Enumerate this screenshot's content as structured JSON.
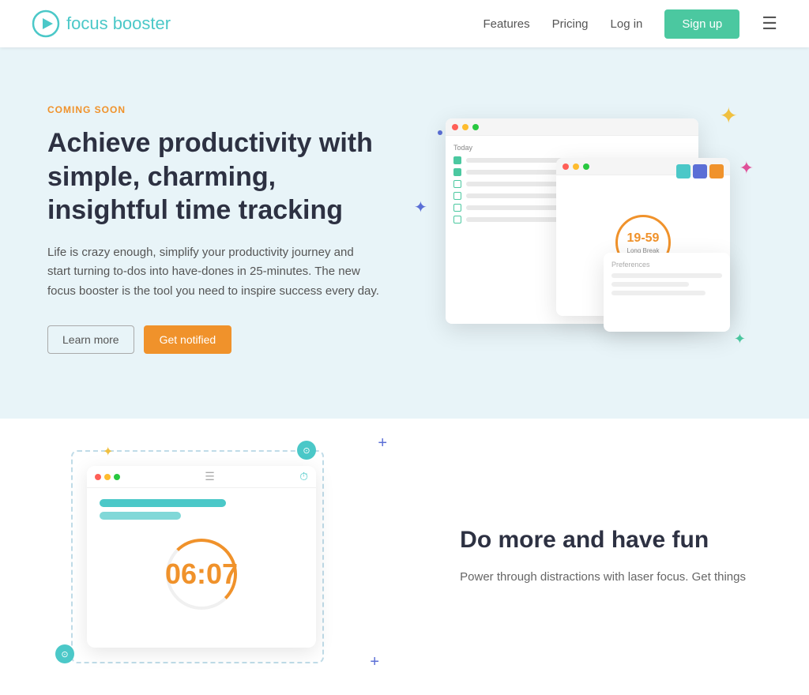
{
  "nav": {
    "logo_text": "focus booster",
    "features_label": "Features",
    "pricing_label": "Pricing",
    "login_label": "Log in",
    "signup_label": "Sign up"
  },
  "hero": {
    "badge": "COMING SOON",
    "title": "Achieve productivity with simple, charming, insightful time tracking",
    "description": "Life is crazy enough, simplify your productivity journey and start turning to-dos into have-dones in 25-minutes. The new focus booster is the tool you need to inspire success every day.",
    "learn_more": "Learn more",
    "get_notified": "Get notified"
  },
  "timer": {
    "display": "19-59",
    "label": "Long Break"
  },
  "section2": {
    "title": "Do more and have fun",
    "description": "Power through distractions with laser focus. Get things",
    "timer_display": "06:07"
  }
}
